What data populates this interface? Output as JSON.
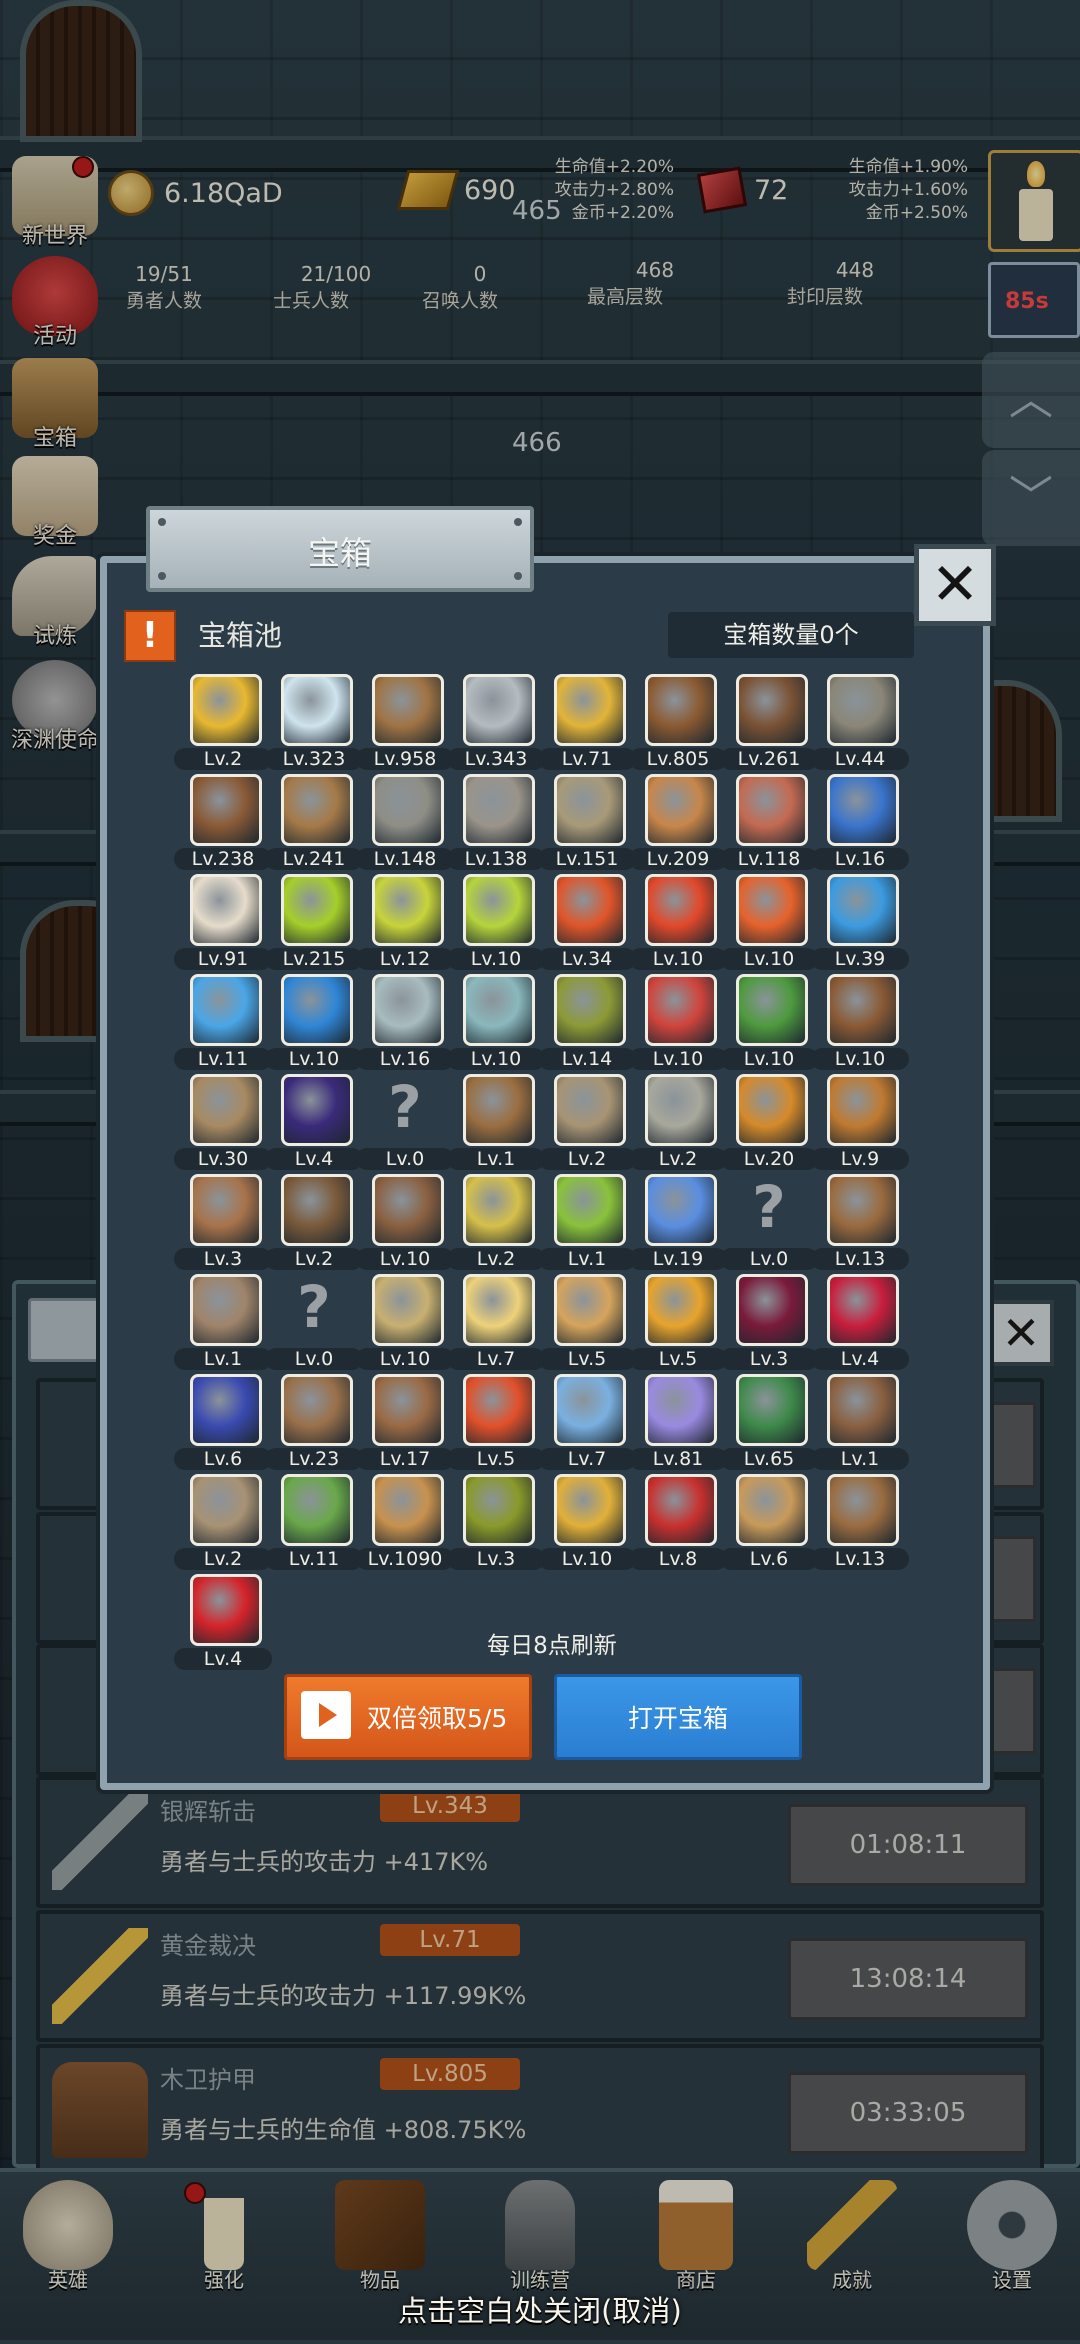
{
  "header": {
    "coins": "6.18QaD",
    "gold_bars": "690",
    "gems": "72",
    "bonus_left": [
      "生命值+2.20%",
      "攻击力+2.80%",
      "金币+2.20%"
    ],
    "bonus_right": [
      "生命值+1.90%",
      "攻击力+1.60%",
      "金币+2.50%"
    ],
    "counts": [
      {
        "value": "19/51",
        "label": "勇者人数"
      },
      {
        "value": "21/100",
        "label": "士兵人数"
      },
      {
        "value": "0",
        "label": "召唤人数"
      },
      {
        "value": "468",
        "label": "最高层数"
      },
      {
        "value": "448",
        "label": "封印层数"
      }
    ]
  },
  "floors": [
    "465",
    "466"
  ],
  "side_menu": [
    "新世界",
    "活动",
    "宝箱",
    "奖金",
    "试炼",
    "深渊使命"
  ],
  "timer_badge": "85s",
  "dialog": {
    "tab_title": "宝箱",
    "pool_title": "宝箱池",
    "chest_count": "宝箱数量0个",
    "refresh_note": "每日8点刷新",
    "double_button": "双倍领取5/5",
    "open_button": "打开宝箱",
    "items": [
      {
        "icon": "crown",
        "level": "Lv.2"
      },
      {
        "icon": "diamond",
        "level": "Lv.323"
      },
      {
        "icon": "wooden-sword",
        "level": "Lv.958"
      },
      {
        "icon": "silver-sword",
        "level": "Lv.343"
      },
      {
        "icon": "gold-sword",
        "level": "Lv.71"
      },
      {
        "icon": "wood-armor",
        "level": "Lv.805"
      },
      {
        "icon": "leather-vest",
        "level": "Lv.261"
      },
      {
        "icon": "iron-armor",
        "level": "Lv.44"
      },
      {
        "icon": "leather-helmet",
        "level": "Lv.238"
      },
      {
        "icon": "wooden-club",
        "level": "Lv.241"
      },
      {
        "icon": "knight-helmet",
        "level": "Lv.148"
      },
      {
        "icon": "hammer",
        "level": "Lv.138"
      },
      {
        "icon": "great-helm",
        "level": "Lv.151"
      },
      {
        "icon": "meat-leg",
        "level": "Lv.209"
      },
      {
        "icon": "steak",
        "level": "Lv.118"
      },
      {
        "icon": "blue-sack",
        "level": "Lv.16"
      },
      {
        "icon": "rice-bowl",
        "level": "Lv.91"
      },
      {
        "icon": "green-potion",
        "level": "Lv.215"
      },
      {
        "icon": "yellow-potion",
        "level": "Lv.12"
      },
      {
        "icon": "lime-potion",
        "level": "Lv.10"
      },
      {
        "icon": "red-potion",
        "level": "Lv.34"
      },
      {
        "icon": "red-potion-large",
        "level": "Lv.10"
      },
      {
        "icon": "orange-potion",
        "level": "Lv.10"
      },
      {
        "icon": "blue-potion",
        "level": "Lv.39"
      },
      {
        "icon": "blue-jar",
        "level": "Lv.11"
      },
      {
        "icon": "blue-flask",
        "level": "Lv.10"
      },
      {
        "icon": "grey-vial",
        "level": "Lv.16"
      },
      {
        "icon": "teal-vial",
        "level": "Lv.10"
      },
      {
        "icon": "olive-bottle",
        "level": "Lv.14"
      },
      {
        "icon": "red-vial",
        "level": "Lv.10"
      },
      {
        "icon": "winged-boot",
        "level": "Lv.10"
      },
      {
        "icon": "brown-boot",
        "level": "Lv.10"
      },
      {
        "icon": "tan-boot",
        "level": "Lv.30"
      },
      {
        "icon": "purple-boot",
        "level": "Lv.4"
      },
      {
        "icon": "unknown",
        "level": "Lv.0"
      },
      {
        "icon": "wooden-staff",
        "level": "Lv.1"
      },
      {
        "icon": "round-shield",
        "level": "Lv.2"
      },
      {
        "icon": "short-sword",
        "level": "Lv.2"
      },
      {
        "icon": "fire-torch",
        "level": "Lv.20"
      },
      {
        "icon": "fire-wand",
        "level": "Lv.9"
      },
      {
        "icon": "mushroom",
        "level": "Lv.3"
      },
      {
        "icon": "pickaxe",
        "level": "Lv.2"
      },
      {
        "icon": "crook-staff",
        "level": "Lv.10"
      },
      {
        "icon": "lemons",
        "level": "Lv.2"
      },
      {
        "icon": "limes",
        "level": "Lv.1"
      },
      {
        "icon": "blue-scepter",
        "level": "Lv.19"
      },
      {
        "icon": "unknown",
        "level": "Lv.0"
      },
      {
        "icon": "backpack",
        "level": "Lv.13"
      },
      {
        "icon": "shovel",
        "level": "Lv.1"
      },
      {
        "icon": "unknown",
        "level": "Lv.0"
      },
      {
        "icon": "broom",
        "level": "Lv.10"
      },
      {
        "icon": "cheese",
        "level": "Lv.7"
      },
      {
        "icon": "pie",
        "level": "Lv.5"
      },
      {
        "icon": "honey-jar",
        "level": "Lv.5"
      },
      {
        "icon": "dark-crystal",
        "level": "Lv.3"
      },
      {
        "icon": "red-orb",
        "level": "Lv.4"
      },
      {
        "icon": "rune-cube",
        "level": "Lv.6"
      },
      {
        "icon": "bow",
        "level": "Lv.23"
      },
      {
        "icon": "crossbow",
        "level": "Lv.17"
      },
      {
        "icon": "flame-emblem",
        "level": "Lv.5"
      },
      {
        "icon": "frost-emblem",
        "level": "Lv.7"
      },
      {
        "icon": "spirit-emblem",
        "level": "Lv.81"
      },
      {
        "icon": "leaf-emblem",
        "level": "Lv.65"
      },
      {
        "icon": "leather-belt",
        "level": "Lv.1"
      },
      {
        "icon": "arrow",
        "level": "Lv.2"
      },
      {
        "icon": "green-wand",
        "level": "Lv.11"
      },
      {
        "icon": "beer-mug",
        "level": "Lv.1090"
      },
      {
        "icon": "vine",
        "level": "Lv.3"
      },
      {
        "icon": "golden-arrow",
        "level": "Lv.10"
      },
      {
        "icon": "spell-book",
        "level": "Lv.8"
      },
      {
        "icon": "scroll",
        "level": "Lv.6"
      },
      {
        "icon": "longbow",
        "level": "Lv.13"
      },
      {
        "icon": "red-card",
        "level": "Lv.4"
      }
    ]
  },
  "hero_rows": [
    {
      "name": "银辉斩击",
      "level": "Lv.343",
      "desc": "勇者与士兵的攻击力 +417K%",
      "timer": "01:08:11"
    },
    {
      "name": "黄金裁决",
      "level": "Lv.71",
      "desc": "勇者与士兵的攻击力 +117.99K%",
      "timer": "13:08:14"
    },
    {
      "name": "木卫护甲",
      "level": "Lv.805",
      "desc": "勇者与士兵的生命值 +808.75K%",
      "timer": "03:33:05"
    }
  ],
  "nav": [
    "英雄",
    "强化",
    "物品",
    "训练营",
    "商店",
    "成就",
    "设置"
  ],
  "close_hint": "点击空白处关闭(取消)",
  "colors": {
    "accent_orange": "#e2621d",
    "button_blue": "#2f88dc",
    "level_badge": "#b5521a",
    "dialog_bg": "#2b3b47"
  }
}
